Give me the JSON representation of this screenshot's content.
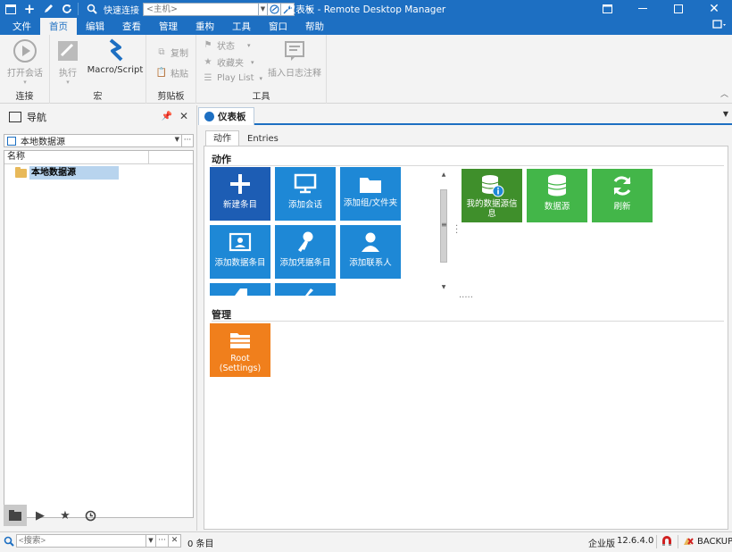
{
  "titlebar": {
    "quick_connect_label": "快速连接",
    "host_placeholder": "<主机>",
    "title": "仪表板 - Remote Desktop Manager"
  },
  "menu": {
    "items": [
      "文件",
      "首页",
      "编辑",
      "查看",
      "管理",
      "重构",
      "工具",
      "窗口",
      "帮助"
    ],
    "active": "首页"
  },
  "ribbon": {
    "groups": {
      "connect": "连接",
      "macro": "宏",
      "clipboard": "剪贴板",
      "tools": "工具"
    },
    "buttons": {
      "open_session": "打开会话",
      "execute": "执行",
      "macro_script": "Macro/Script",
      "copy": "复制",
      "paste": "粘贴",
      "status": "状态",
      "favorites": "收藏夹",
      "play_list": "Play List",
      "insert_log": "插入日志注释"
    }
  },
  "nav": {
    "title": "导航",
    "datasource": "本地数据源",
    "column_name": "名称",
    "tree_items": [
      "本地数据源"
    ]
  },
  "dashboard": {
    "tab": "仪表板",
    "subtabs": [
      "动作",
      "Entries"
    ],
    "actions_title": "动作",
    "manage_title": "管理",
    "action_tiles": [
      "新建条目",
      "添加会话",
      "添加组/文件夹",
      "添加数据条目",
      "添加凭据条目",
      "添加联系人"
    ],
    "info_tiles": [
      "我的数据源信息",
      "数据源",
      "刷新"
    ],
    "manage_tiles": [
      "Root (Settings)"
    ]
  },
  "statusbar": {
    "search_placeholder": "<搜索>",
    "count": "0 条目",
    "edition": "企业版",
    "version": "12.6.4.0",
    "backup": "BACKUP"
  },
  "colors": {
    "accent": "#1d6fc2",
    "tile_blue": "#1e88d6",
    "tile_darkblue": "#1d5db4",
    "tile_darkgreen": "#3f8f2b",
    "tile_green": "#43b649",
    "tile_orange": "#f07f1c"
  }
}
